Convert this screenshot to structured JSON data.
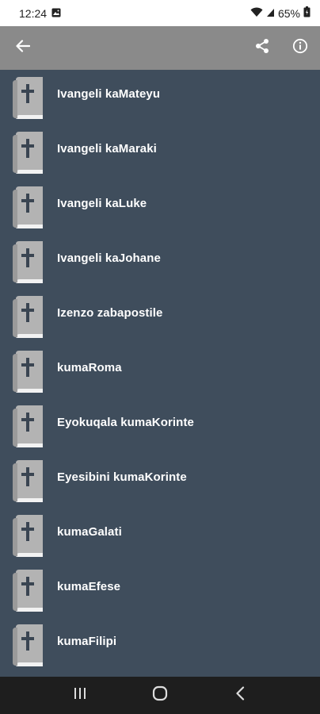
{
  "status_bar": {
    "time": "12:24",
    "battery": "65%"
  },
  "app_bar": {
    "back_icon": "arrow-left-icon",
    "share_icon": "share-icon",
    "info_icon": "info-icon"
  },
  "books": [
    {
      "label": "Ivangeli kaMateyu"
    },
    {
      "label": "Ivangeli kaMaraki"
    },
    {
      "label": "Ivangeli kaLuke"
    },
    {
      "label": "Ivangeli kaJohane"
    },
    {
      "label": "Izenzo zabapostile"
    },
    {
      "label": "kumaRoma"
    },
    {
      "label": "Eyokuqala kumaKorinte"
    },
    {
      "label": "Eyesibini kumaKorinte"
    },
    {
      "label": "kumaGalati"
    },
    {
      "label": "kumaEfese"
    },
    {
      "label": "kumaFilipi"
    }
  ],
  "colors": {
    "background": "#3f4d5c",
    "app_bar": "#8a8a8a",
    "icon_book": "#b3b3b3",
    "nav_bar": "#1e1e1e"
  }
}
